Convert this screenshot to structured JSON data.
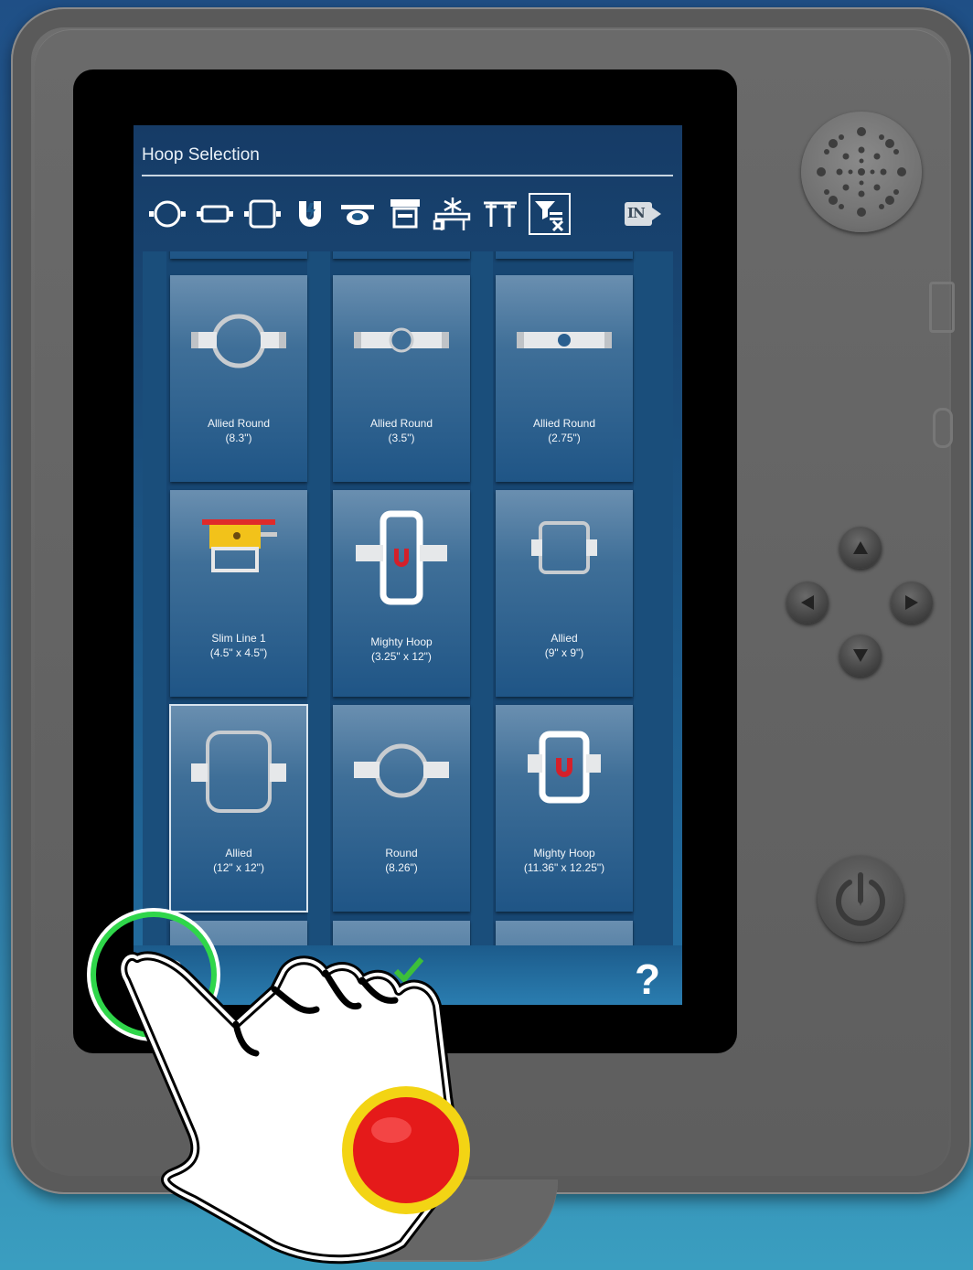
{
  "screen": {
    "title": "Hoop Selection",
    "unit_toggle_label": "IN"
  },
  "toolbar": {
    "items": [
      {
        "icon": "round-hoop-filter-icon"
      },
      {
        "icon": "rectangle-hoop-filter-icon"
      },
      {
        "icon": "square-hoop-filter-icon"
      },
      {
        "icon": "magnetic-hoop-filter-icon"
      },
      {
        "icon": "cap-hoop-filter-icon"
      },
      {
        "icon": "frame-hoop-filter-icon"
      },
      {
        "icon": "specialty-hoop-filter-icon"
      },
      {
        "icon": "clamp-hoop-filter-icon"
      },
      {
        "icon": "clear-filter-icon",
        "selected": true
      }
    ]
  },
  "hoops": [
    {
      "name": "Allied Round",
      "size": "(8.3\")",
      "shape": "round-large"
    },
    {
      "name": "Allied Round",
      "size": "(3.5\")",
      "shape": "round-small"
    },
    {
      "name": "Allied Round",
      "size": "(2.75\")",
      "shape": "round-tiny"
    },
    {
      "name": "Slim Line 1",
      "size": "(4.5\" x 4.5\")",
      "shape": "slimline"
    },
    {
      "name": "Mighty Hoop",
      "size": "(3.25\" x 12\")",
      "shape": "mighty-tall"
    },
    {
      "name": "Allied",
      "size": "(9\" x 9\")",
      "shape": "square"
    },
    {
      "name": "Allied",
      "size": "(12\" x 12\")",
      "shape": "square-large",
      "selected": true
    },
    {
      "name": "Round",
      "size": "(8.26\")",
      "shape": "round-large"
    },
    {
      "name": "Mighty Hoop",
      "size": "(11.36\" x 12.25\")",
      "shape": "mighty-square"
    }
  ],
  "bottom_bar": {
    "help_label": "?"
  },
  "colors": {
    "highlight_ring": "#2fd64a",
    "magnet_red": "#d4202a",
    "confirm_green": "#3cbf3a",
    "tap_marker": "#e51a1a"
  }
}
